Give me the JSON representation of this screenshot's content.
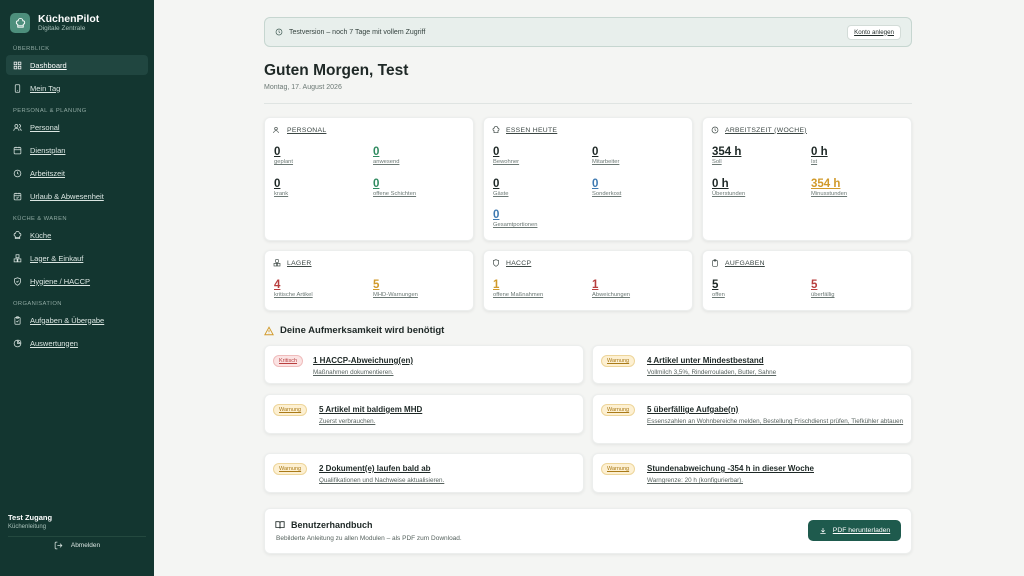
{
  "app": {
    "name": "KüchenPilot",
    "subtitle": "Digitale Zentrale"
  },
  "sidebar": {
    "sections": [
      {
        "label": "ÜBERBLICK",
        "items": [
          {
            "label": "Dashboard",
            "icon": "dashboard-icon",
            "active": true
          },
          {
            "label": "Mein Tag",
            "icon": "phone-icon"
          }
        ]
      },
      {
        "label": "PERSONAL & PLANUNG",
        "items": [
          {
            "label": "Personal",
            "icon": "users-icon"
          },
          {
            "label": "Dienstplan",
            "icon": "calendar-icon"
          },
          {
            "label": "Arbeitszeit",
            "icon": "clock-icon"
          },
          {
            "label": "Urlaub & Abwesenheit",
            "icon": "calendar-check-icon"
          }
        ]
      },
      {
        "label": "KÜCHE & WAREN",
        "items": [
          {
            "label": "Küche",
            "icon": "chef-hat-icon"
          },
          {
            "label": "Lager & Einkauf",
            "icon": "boxes-icon"
          },
          {
            "label": "Hygiene / HACCP",
            "icon": "shield-icon"
          }
        ]
      },
      {
        "label": "ORGANISATION",
        "items": [
          {
            "label": "Aufgaben & Übergabe",
            "icon": "clipboard-icon"
          },
          {
            "label": "Auswertungen",
            "icon": "chart-icon"
          }
        ]
      }
    ],
    "user": {
      "name": "Test Zugang",
      "role": "Küchenleitung"
    },
    "logout_label": "Abmelden"
  },
  "trial": {
    "text": "Testversion – noch 7 Tage mit vollem Zugriff",
    "button": "Konto anlegen"
  },
  "greeting": "Guten Morgen, Test",
  "date": "Montag, 17. August 2026",
  "cards": {
    "personal": {
      "title": "PERSONAL",
      "stats": [
        {
          "value": "0",
          "label": "geplant"
        },
        {
          "value": "0",
          "label": "anwesend"
        },
        {
          "value": "0",
          "label": "krank"
        },
        {
          "value": "0",
          "label": "offene Schichten"
        }
      ]
    },
    "essen": {
      "title": "ESSEN HEUTE",
      "stats": [
        {
          "value": "0",
          "label": "Bewohner"
        },
        {
          "value": "0",
          "label": "Mitarbeiter"
        },
        {
          "value": "0",
          "label": "Gäste"
        },
        {
          "value": "0",
          "label": "Sonderkost"
        },
        {
          "value": "0",
          "label": "Gesamtportionen"
        }
      ]
    },
    "arbeitszeit": {
      "title": "ARBEITSZEIT (WOCHE)",
      "stats": [
        {
          "value": "354 h",
          "label": "Soll"
        },
        {
          "value": "0 h",
          "label": "Ist"
        },
        {
          "value": "0 h",
          "label": "Überstunden"
        },
        {
          "value": "354 h",
          "label": "Minusstunden"
        }
      ]
    },
    "lager": {
      "title": "LAGER",
      "stats": [
        {
          "value": "4",
          "label": "kritische Artikel"
        },
        {
          "value": "5",
          "label": "MHD-Warnungen"
        }
      ]
    },
    "haccp": {
      "title": "HACCP",
      "stats": [
        {
          "value": "1",
          "label": "offene Maßnahmen"
        },
        {
          "value": "1",
          "label": "Abweichungen"
        }
      ]
    },
    "aufgaben": {
      "title": "AUFGABEN",
      "stats": [
        {
          "value": "5",
          "label": "offen"
        },
        {
          "value": "5",
          "label": "überfällig"
        }
      ]
    }
  },
  "attention": {
    "title": "Deine Aufmerksamkeit wird benötigt",
    "alerts": [
      {
        "badge": "Kritisch",
        "title": "1 HACCP-Abweichung(en)",
        "desc": "Maßnahmen dokumentieren."
      },
      {
        "badge": "Warnung",
        "title": "4 Artikel unter Mindestbestand",
        "desc": "Vollmilch 3,5%, Rinderrouladen, Butter, Sahne"
      },
      {
        "badge": "Warnung",
        "title": "5 Artikel mit baldigem MHD",
        "desc": "Zuerst verbrauchen."
      },
      {
        "badge": "Warnung",
        "title": "5 überfällige Aufgabe(n)",
        "desc": "Essenszahlen an Wohnbereiche melden, Bestellung Frischdienst prüfen, Tiefkühler abtauen"
      },
      {
        "badge": "Warnung",
        "title": "2 Dokument(e) laufen bald ab",
        "desc": "Qualifikationen und Nachweise aktualisieren."
      },
      {
        "badge": "Warnung",
        "title": "Stundenabweichung -354 h in dieser Woche",
        "desc": "Warngrenze: 20 h (konfigurierbar)."
      }
    ]
  },
  "handbook": {
    "title": "Benutzerhandbuch",
    "desc": "Bebilderte Anleitung zu allen Modulen – als PDF zum Download.",
    "button": "PDF herunterladen"
  },
  "colors": {
    "sidebar": "#133630",
    "accent": "#1e5a4d",
    "green": "#2e8a5f",
    "blue": "#3d79b1",
    "amber": "#d19a2a",
    "red": "#b83e3e"
  }
}
